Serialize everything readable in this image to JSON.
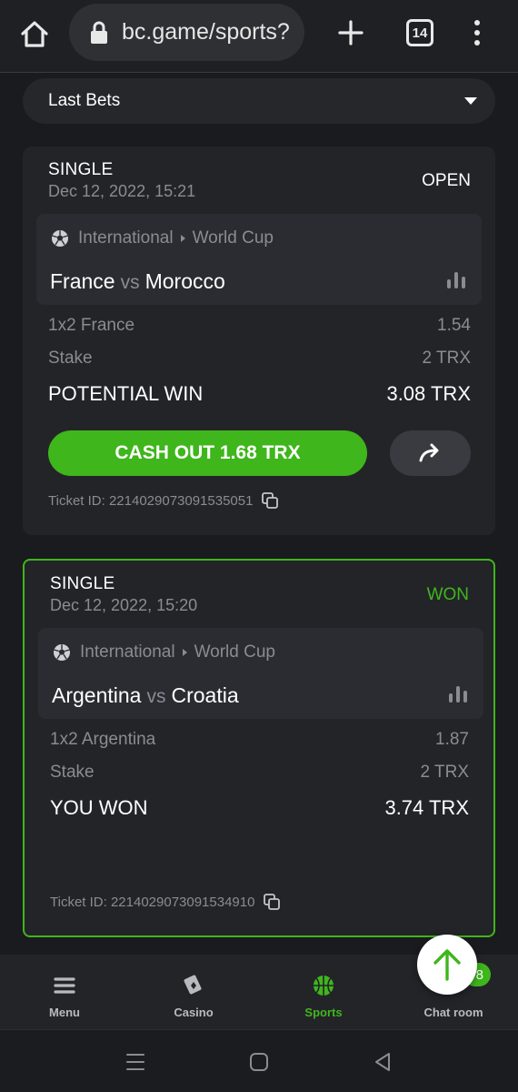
{
  "browser": {
    "url": "bc.game/sports?",
    "tab_count": "14"
  },
  "last_bets": {
    "label": "Last Bets"
  },
  "bets": [
    {
      "type": "SINGLE",
      "date": "Dec 12, 2022, 15:21",
      "status": "OPEN",
      "league": "International",
      "competition": "World Cup",
      "home_team": "France",
      "vs": "vs",
      "away_team": "Morocco",
      "market_label": "1x2 France",
      "odds": "1.54",
      "stake_label": "Stake",
      "stake_value": "2 TRX",
      "win_label": "POTENTIAL WIN",
      "win_value": "3.08 TRX",
      "cashout_label": "CASH OUT 1.68 TRX",
      "ticket_id": "Ticket ID: 2214029073091535051"
    },
    {
      "type": "SINGLE",
      "date": "Dec 12, 2022, 15:20",
      "status": "WON",
      "league": "International",
      "competition": "World Cup",
      "home_team": "Argentina",
      "vs": "vs",
      "away_team": "Croatia",
      "market_label": "1x2 Argentina",
      "odds": "1.87",
      "stake_label": "Stake",
      "stake_value": "2 TRX",
      "win_label": "YOU WON",
      "win_value": "3.74 TRX",
      "ticket_id": "Ticket ID: 2214029073091534910"
    }
  ],
  "bottom_nav": {
    "items": [
      {
        "label": "Menu",
        "icon": "hamburger-icon"
      },
      {
        "label": "Casino",
        "icon": "casino-cards-icon"
      },
      {
        "label": "Sports",
        "icon": "basketball-icon"
      },
      {
        "label": "Chat room",
        "icon": "chat-icon"
      }
    ],
    "active": "Sports",
    "chat_badge": "8"
  },
  "colors": {
    "accent": "#3fb61c",
    "background": "#1a1b1e",
    "card": "#232428"
  }
}
